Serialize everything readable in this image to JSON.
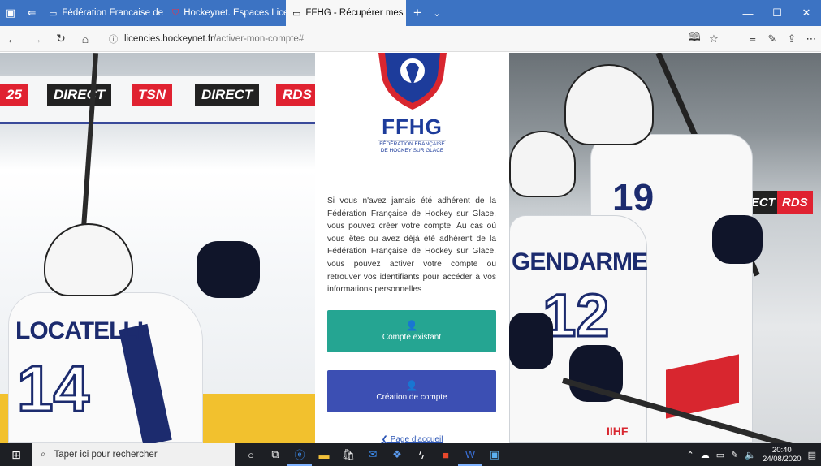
{
  "browser": {
    "tabs": [
      {
        "title": "Fédération Francaise de Ho",
        "icon": "page-icon",
        "active": false
      },
      {
        "title": "Hockeynet. Espaces Licencié",
        "icon": "shield-icon",
        "active": false
      },
      {
        "title": "FFHG - Récupérer mes i",
        "icon": "page-icon",
        "active": true
      }
    ],
    "address": {
      "host": "licencies.hockeynet.fr",
      "path": "/activer-mon-compte#"
    }
  },
  "background": {
    "ads_left": [
      "25",
      "DIRECT",
      "TSN",
      "DIRECT",
      "RDS"
    ],
    "player_left": {
      "name": "LOCATELLI",
      "number": "14"
    },
    "player_right_back": {
      "number": "19"
    },
    "player_right_front": {
      "name": "GENDARME",
      "number": "12"
    },
    "ads_right": [
      "DIRECT",
      "RDS"
    ],
    "iihf": "IIHF"
  },
  "panel": {
    "logo": {
      "title": "FFHG",
      "subtitle_line1": "FÉDÉRATION FRANÇAISE",
      "subtitle_line2": "DE HOCKEY SUR GLACE"
    },
    "description": "Si vous n'avez jamais été adhérent de la Fédération Française de Hockey sur Glace, vous pouvez créer votre compte. Au cas où vous êtes ou avez déjà été adhérent de la Fédération Française de Hockey sur Glace, vous pouvez activer votre compte ou retrouver vos identifiants pour accéder à vos informations personnelles",
    "buttons": {
      "existing": "Compte existant",
      "create": "Création de compte"
    },
    "home_link": "❮ Page d'accueil"
  },
  "taskbar": {
    "search_placeholder": "Taper ici pour rechercher",
    "time": "20:40",
    "date": "24/08/2020"
  },
  "colors": {
    "tabbar": "#3c73c3",
    "existing_button": "#25a592",
    "create_button": "#3c4fb3",
    "logo_blue": "#1d3c9b",
    "logo_red": "#d8262f"
  }
}
